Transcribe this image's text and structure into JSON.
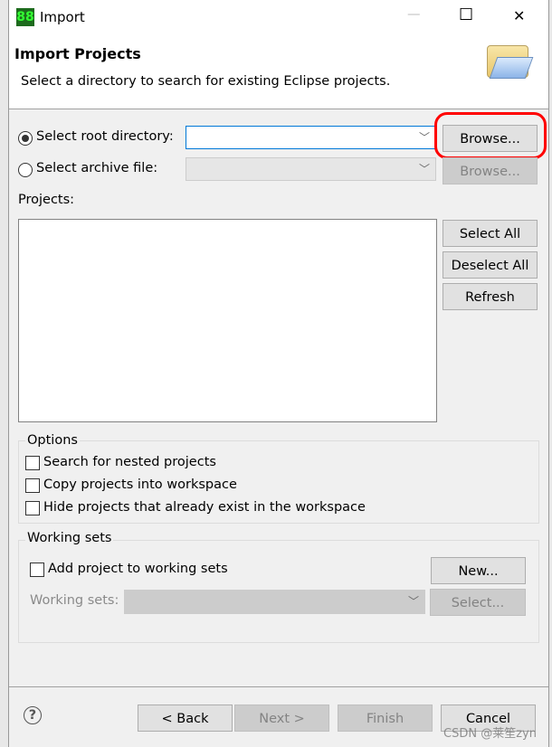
{
  "window": {
    "title": "Import",
    "minimize": "—",
    "maximize": "☐",
    "close": "✕"
  },
  "header": {
    "title": "Import Projects",
    "description": "Select a directory to search for existing Eclipse projects."
  },
  "source": {
    "root_label": "Select root directory:",
    "root_value": "",
    "root_selected": true,
    "archive_label": "Select archive file:",
    "archive_value": "",
    "browse_label": "Browse...",
    "browse_archive_label": "Browse..."
  },
  "projects": {
    "label": "Projects:",
    "items": [],
    "select_all": "Select All",
    "deselect_all": "Deselect All",
    "refresh": "Refresh"
  },
  "options": {
    "title": "Options",
    "items": [
      {
        "label": "Search for nested projects",
        "checked": false
      },
      {
        "label": "Copy projects into workspace",
        "checked": false
      },
      {
        "label": "Hide projects that already exist in the workspace",
        "checked": false
      }
    ]
  },
  "working_sets": {
    "title": "Working sets",
    "add_label": "Add project to working sets",
    "add_checked": false,
    "new_label": "New...",
    "sets_label": "Working sets:",
    "select_label": "Select..."
  },
  "footer": {
    "back": "< Back",
    "next": "Next >",
    "finish": "Finish",
    "cancel": "Cancel"
  },
  "watermark": "CSDN @莱笙zyn",
  "annotation_color": "#ff0000"
}
